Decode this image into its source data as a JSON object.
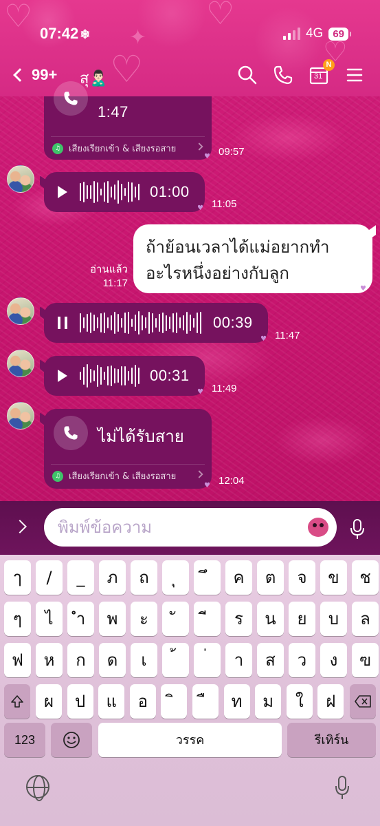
{
  "status": {
    "time": "07:42",
    "time_icon": "snowflake-icon",
    "network": "4G",
    "battery": "69"
  },
  "header": {
    "back_count": "99+",
    "title": "สุ",
    "title_emoji": "🙎🏻‍♂️",
    "calendar_day": "31",
    "calendar_badge": "N"
  },
  "messages": {
    "call1": {
      "duration": "1:47",
      "footer": "เสียงเรียกเข้า & เสียงรอสาย",
      "time": "09:57"
    },
    "voice1": {
      "duration": "01:00",
      "time": "11:05"
    },
    "outgoing": {
      "text_line1": "ถ้าย้อนเวลาได้แม่อยากทำ",
      "text_line2": "อะไรหนึ่งอย่างกับลูก",
      "read_label": "อ่านแล้ว",
      "time": "11:17"
    },
    "voice2": {
      "duration": "00:39",
      "time": "11:47",
      "state": "playing"
    },
    "voice3": {
      "duration": "00:31",
      "time": "11:49"
    },
    "call2": {
      "label": "ไม่ได้รับสาย",
      "footer": "เสียงเรียกเข้า & เสียงรอสาย",
      "time": "12:04"
    }
  },
  "input": {
    "placeholder": "พิมพ์ข้อความ"
  },
  "keyboard": {
    "row1": [
      "ๅ",
      "/",
      "_",
      "ภ",
      "ถ",
      "ุ",
      "ึ",
      "ค",
      "ต",
      "จ",
      "ข",
      "ช"
    ],
    "row2": [
      "ๆ",
      "ไ",
      "ำ",
      "พ",
      "ะ",
      "ั",
      "ี",
      "ร",
      "น",
      "ย",
      "บ",
      "ล"
    ],
    "row3": [
      "ฟ",
      "ห",
      "ก",
      "ด",
      "เ",
      "้",
      "่",
      "า",
      "ส",
      "ว",
      "ง",
      "ฃ"
    ],
    "row4": [
      "ผ",
      "ป",
      "แ",
      "อ",
      "ิ",
      "ื",
      "ท",
      "ม",
      "ใ",
      "ฝ"
    ],
    "numbers_label": "123",
    "space_label": "วรรค",
    "return_label": "รีเทิร์น"
  },
  "colors": {
    "chat_bg": "#c9186f",
    "bubble": "#76125e",
    "header": "#e5388f",
    "keyboard": "#e5c8df"
  }
}
